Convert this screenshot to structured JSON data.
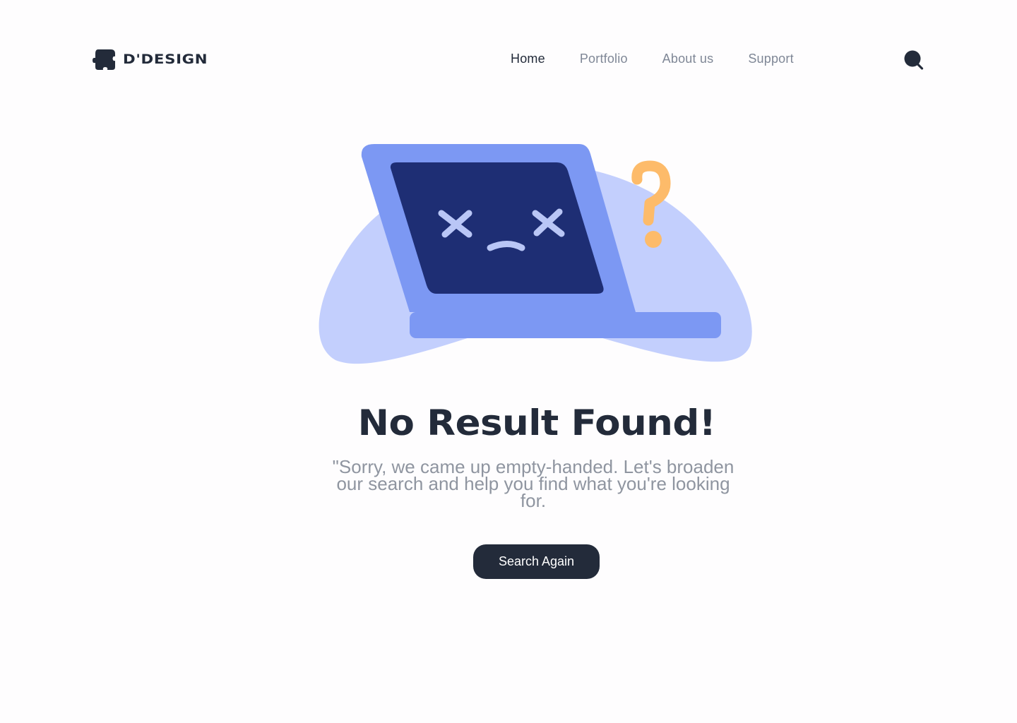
{
  "brand": {
    "name": "D'DESIGN",
    "logo_icon": "puzzle-piece-icon"
  },
  "nav": {
    "items": [
      {
        "label": "Home",
        "active": true
      },
      {
        "label": "Portfolio",
        "active": false
      },
      {
        "label": "About us",
        "active": false
      },
      {
        "label": "Support",
        "active": false
      }
    ],
    "search_icon": "search-icon"
  },
  "illustration": {
    "subject": "sad-laptop-icon",
    "accent": "question-mark-icon"
  },
  "main": {
    "title": "No Result Found!",
    "message": "\"Sorry, we came up empty-handed. Let's broaden our search and help you find what you're looking for.",
    "cta_label": "Search Again"
  },
  "colors": {
    "text_dark": "#232b3a",
    "text_muted": "#8f95a0",
    "nav_inactive": "#7f8796",
    "blob": "#c3cffd",
    "laptop_body": "#7c98f3",
    "screen": "#1e2e74",
    "face": "#b9c6f6",
    "question_mark": "#fdbb6a",
    "button": "#232b3a",
    "background": "#fefdfe"
  }
}
